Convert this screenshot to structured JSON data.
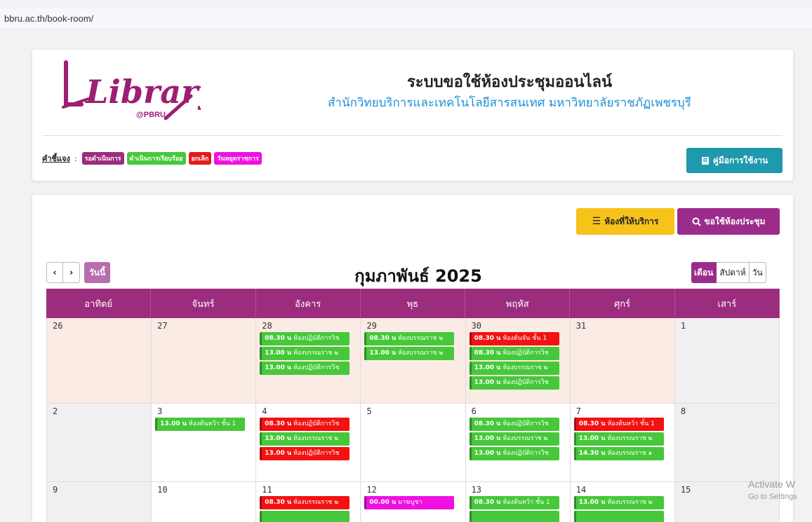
{
  "browser": {
    "url": "bbru.ac.th/book-room/"
  },
  "header": {
    "logo_text": "Library",
    "logo_sub": "@PBRU",
    "title": "ระบบขอใช้ห้องประชุมออนไลน์",
    "subtitle": "สำนักวิทยบริการและเทคโนโลยีสารสนเทศ มหาวิทยาลัยราชภัฏเพชรบุรี",
    "legend_label": "คำชี้แจง",
    "legend_items": [
      {
        "label": "รอดำเนินการ",
        "color": "#9c2c7d"
      },
      {
        "label": "ดำเนินการเรียบร้อย",
        "color": "#46c83a"
      },
      {
        "label": "ยกเลิก",
        "color": "#e21b1b"
      },
      {
        "label": "วันหยุดราชการ",
        "color": "#f010e2"
      }
    ],
    "manual_button": "คู่มือการใช้งาน"
  },
  "toolbar": {
    "rooms_button": "ห้องที่ให้บริการ",
    "book_button": "ขอใช้ห้องประชุม"
  },
  "calendar": {
    "today_button": "วันนี้",
    "title": "กุมภาพันธ์ 2025",
    "views": [
      "เดือน",
      "สัปดาห์",
      "วัน"
    ],
    "weekdays": [
      "อาทิตย์",
      "จันทร์",
      "อังคาร",
      "พุธ",
      "พฤหัส",
      "ศุกร์",
      "เสาร์"
    ],
    "weeks": [
      [
        {
          "day": "26",
          "other": true,
          "events": []
        },
        {
          "day": "27",
          "other": true,
          "events": []
        },
        {
          "day": "28",
          "other": true,
          "events": [
            {
              "time": "08.30 น",
              "title": "ห้องปฏิบัติการวิช",
              "status": "green"
            },
            {
              "time": "13.00 น",
              "title": "ห้องบรรณราช ๒",
              "status": "green"
            },
            {
              "time": "13.00 น",
              "title": "ห้องปฏิบัติการวิช",
              "status": "green"
            }
          ]
        },
        {
          "day": "29",
          "other": true,
          "events": [
            {
              "time": "08.30 น",
              "title": "ห้องบรรณราช ๒",
              "status": "green"
            },
            {
              "time": "13.00 น",
              "title": "ห้องบรรณราช ๒",
              "status": "green"
            }
          ]
        },
        {
          "day": "30",
          "other": true,
          "events": [
            {
              "time": "08.30 น",
              "title": "ห้องต้นจัน ชั้น 1",
              "status": "red"
            },
            {
              "time": "08.30 น",
              "title": "ห้องปฏิบัติการวิช",
              "status": "green"
            },
            {
              "time": "13.00 น",
              "title": "ห้องบรรณราช ๒",
              "status": "green"
            },
            {
              "time": "13.00 น",
              "title": "ห้องปฏิบัติการวิช",
              "status": "green"
            }
          ]
        },
        {
          "day": "31",
          "other": true,
          "events": []
        },
        {
          "day": "1",
          "weekend": true,
          "events": []
        }
      ],
      [
        {
          "day": "2",
          "weekend": true,
          "events": []
        },
        {
          "day": "3",
          "events": [
            {
              "time": "13.00 น",
              "title": "ห้องต้นหว้า ชั้น 1",
              "status": "green"
            }
          ]
        },
        {
          "day": "4",
          "events": [
            {
              "time": "08.30 น",
              "title": "ห้องปฏิบัติการวิช",
              "status": "red"
            },
            {
              "time": "13.00 น",
              "title": "ห้องบรรณราช ๒",
              "status": "green"
            },
            {
              "time": "13.00 น",
              "title": "ห้องปฏิบัติการวิช",
              "status": "red"
            }
          ]
        },
        {
          "day": "5",
          "events": []
        },
        {
          "day": "6",
          "events": [
            {
              "time": "08.30 น",
              "title": "ห้องปฏิบัติการวิช",
              "status": "green"
            },
            {
              "time": "13.00 น",
              "title": "ห้องบรรณราช ๒",
              "status": "green"
            },
            {
              "time": "13.00 น",
              "title": "ห้องปฏิบัติการวิช",
              "status": "green"
            }
          ]
        },
        {
          "day": "7",
          "events": [
            {
              "time": "08.30 น",
              "title": "ห้องต้นหว้า ชั้น 1",
              "status": "red"
            },
            {
              "time": "13.00 น",
              "title": "ห้องบรรณราช ๒",
              "status": "green"
            },
            {
              "time": "14.30 น",
              "title": "ห้องบรรณราช ๑",
              "status": "green"
            }
          ]
        },
        {
          "day": "8",
          "weekend": true,
          "events": []
        }
      ],
      [
        {
          "day": "9",
          "weekend": true,
          "events": []
        },
        {
          "day": "10",
          "events": []
        },
        {
          "day": "11",
          "events": [
            {
              "time": "08.30 น",
              "title": "ห้องบรรณราช ๒",
              "status": "red"
            },
            {
              "time": "",
              "title": "",
              "status": "green"
            }
          ]
        },
        {
          "day": "12",
          "events": [
            {
              "time": "00.00 น",
              "title": "มาฆบูชา",
              "status": "magenta"
            }
          ]
        },
        {
          "day": "13",
          "events": [
            {
              "time": "08.30 น",
              "title": "ห้องต้นหว้า ชั้น 1",
              "status": "green"
            },
            {
              "time": "",
              "title": "",
              "status": "green"
            }
          ]
        },
        {
          "day": "14",
          "events": [
            {
              "time": "13.00 น",
              "title": "ห้องบรรณราช ๒",
              "status": "green"
            },
            {
              "time": "",
              "title": "",
              "status": "green"
            }
          ]
        },
        {
          "day": "15",
          "weekend": true,
          "events": []
        }
      ]
    ]
  },
  "watermark": {
    "line1": "Activate W",
    "line2": "Go to Settings"
  }
}
